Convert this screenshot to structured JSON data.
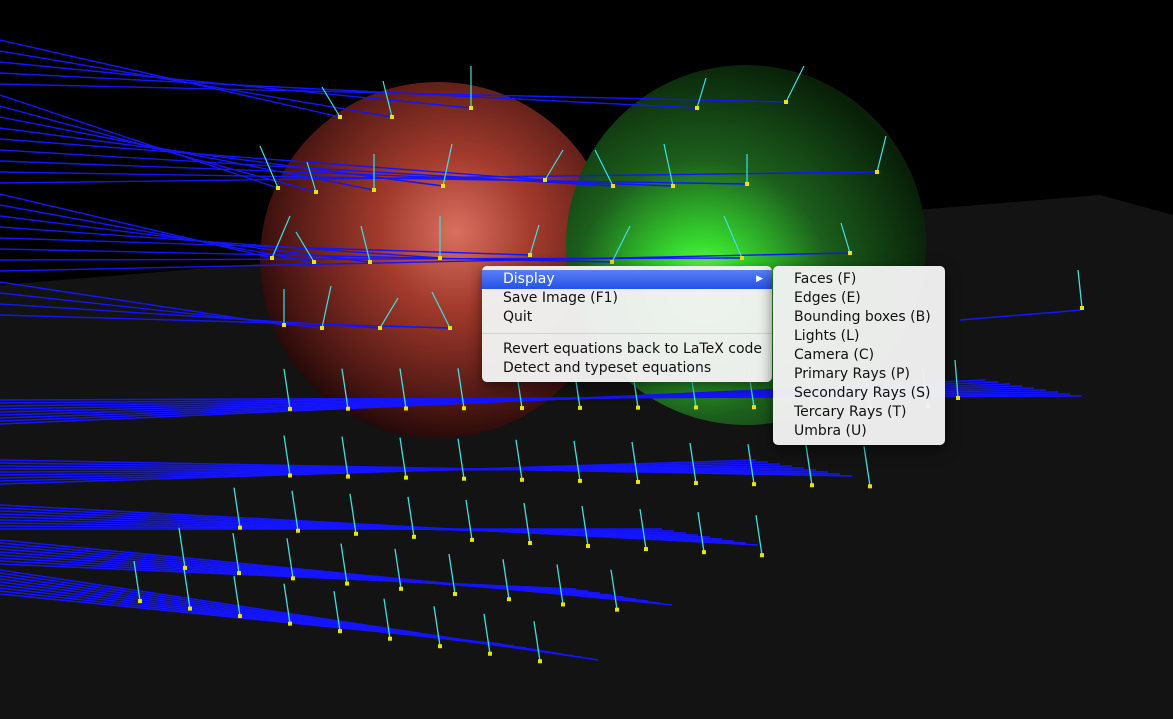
{
  "colors": {
    "background": "#000000",
    "floor": "#131313",
    "primary_ray": "#1414ff",
    "secondary_ray": "#40e0e0",
    "hit_marker": "#e6e600",
    "sphere_red": "#b43c2d",
    "sphere_green": "#2fae2f",
    "menu_highlight": "#2f5fe8"
  },
  "context_menu": {
    "items": [
      {
        "label": "Display",
        "has_submenu": true,
        "active": true
      },
      {
        "label": "Save Image (F1)"
      },
      {
        "label": "Quit"
      },
      {
        "label": "Revert equations back to LaTeX code"
      },
      {
        "label": "Detect and typeset equations"
      }
    ],
    "submenu_arrow": "▶"
  },
  "display_submenu": {
    "items": [
      {
        "label": "Faces (F)"
      },
      {
        "label": "Edges (E)"
      },
      {
        "label": "Bounding boxes (B)"
      },
      {
        "label": "Lights (L)"
      },
      {
        "label": "Camera (C)"
      },
      {
        "label": "Primary Rays (P)"
      },
      {
        "label": "Secondary Rays (S)"
      },
      {
        "label": "Tercary Rays (T)"
      },
      {
        "label": "Umbra (U)"
      }
    ]
  }
}
